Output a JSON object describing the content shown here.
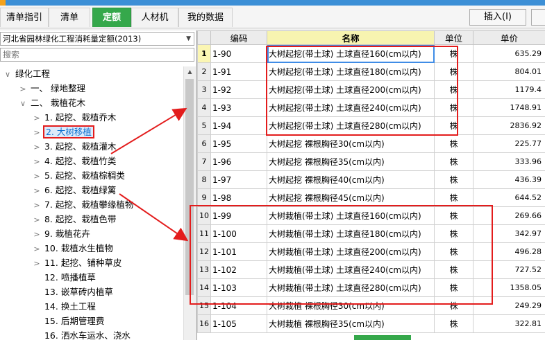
{
  "tabs": [
    {
      "label": "清单指引",
      "active": false
    },
    {
      "label": "清单",
      "active": false
    },
    {
      "label": "定额",
      "active": true
    },
    {
      "label": "人材机",
      "active": false
    },
    {
      "label": "我的数据",
      "active": false
    }
  ],
  "toolbar": {
    "insert_label": "插入(I)"
  },
  "library_select": {
    "value": "河北省园林绿化工程消耗量定额(2013)"
  },
  "search": {
    "placeholder": "搜索"
  },
  "tree": [
    {
      "toggle": "∨",
      "label": "绿化工程",
      "level": 0
    },
    {
      "toggle": ">",
      "label": "一、  绿地整理",
      "level": 1
    },
    {
      "toggle": "∨",
      "label": "二、  栽植花木",
      "level": 1
    },
    {
      "toggle": ">",
      "label": "1. 起挖、栽植乔木",
      "level": 2
    },
    {
      "toggle": ">",
      "label": "2. 大树移植",
      "level": 2,
      "selected": true
    },
    {
      "toggle": ">",
      "label": "3. 起挖、栽植灌木",
      "level": 2
    },
    {
      "toggle": ">",
      "label": "4. 起挖、栽植竹类",
      "level": 2
    },
    {
      "toggle": ">",
      "label": "5. 起挖、栽植棕榈类",
      "level": 2
    },
    {
      "toggle": ">",
      "label": "6. 起挖、栽植绿篱",
      "level": 2
    },
    {
      "toggle": ">",
      "label": "7. 起挖、栽植攀缘植物",
      "level": 2
    },
    {
      "toggle": ">",
      "label": "8. 起挖、栽植色带",
      "level": 2
    },
    {
      "toggle": ">",
      "label": "9. 栽植花卉",
      "level": 2
    },
    {
      "toggle": ">",
      "label": "10. 栽植水生植物",
      "level": 2
    },
    {
      "toggle": ">",
      "label": "11. 起挖、铺种草皮",
      "level": 2
    },
    {
      "toggle": "",
      "label": "12. 喷播植草",
      "level": 2
    },
    {
      "toggle": "",
      "label": "13. 嵌草砖内植草",
      "level": 2
    },
    {
      "toggle": "",
      "label": "14. 换土工程",
      "level": 2
    },
    {
      "toggle": "",
      "label": "15. 后期管理费",
      "level": 2
    },
    {
      "toggle": "",
      "label": "16. 洒水车运水、浇水",
      "level": 2
    }
  ],
  "columns": {
    "code": "编码",
    "name": "名称",
    "unit": "单位",
    "price": "单价"
  },
  "rows": [
    {
      "idx": "1",
      "code": "1-90",
      "name": "大树起挖(带土球) 土球直径160(cm以内)",
      "unit": "株",
      "price": "635.29"
    },
    {
      "idx": "2",
      "code": "1-91",
      "name": "大树起挖(带土球) 土球直径180(cm以内)",
      "unit": "株",
      "price": "804.01"
    },
    {
      "idx": "3",
      "code": "1-92",
      "name": "大树起挖(带土球) 土球直径200(cm以内)",
      "unit": "株",
      "price": "1179.4"
    },
    {
      "idx": "4",
      "code": "1-93",
      "name": "大树起挖(带土球) 土球直径240(cm以内)",
      "unit": "株",
      "price": "1748.91"
    },
    {
      "idx": "5",
      "code": "1-94",
      "name": "大树起挖(带土球) 土球直径280(cm以内)",
      "unit": "株",
      "price": "2836.92"
    },
    {
      "idx": "6",
      "code": "1-95",
      "name": "大树起挖 裸根胸径30(cm以内)",
      "unit": "株",
      "price": "225.77"
    },
    {
      "idx": "7",
      "code": "1-96",
      "name": "大树起挖 裸根胸径35(cm以内)",
      "unit": "株",
      "price": "333.96"
    },
    {
      "idx": "8",
      "code": "1-97",
      "name": "大树起挖 裸根胸径40(cm以内)",
      "unit": "株",
      "price": "436.39"
    },
    {
      "idx": "9",
      "code": "1-98",
      "name": "大树起挖 裸根胸径45(cm以内)",
      "unit": "株",
      "price": "644.52"
    },
    {
      "idx": "10",
      "code": "1-99",
      "name": "大树栽植(带土球) 土球直径160(cm以内)",
      "unit": "株",
      "price": "269.66"
    },
    {
      "idx": "11",
      "code": "1-100",
      "name": "大树栽植(带土球) 土球直径180(cm以内)",
      "unit": "株",
      "price": "342.97"
    },
    {
      "idx": "12",
      "code": "1-101",
      "name": "大树栽植(带土球) 土球直径200(cm以内)",
      "unit": "株",
      "price": "496.28"
    },
    {
      "idx": "13",
      "code": "1-102",
      "name": "大树栽植(带土球) 土球直径240(cm以内)",
      "unit": "株",
      "price": "727.52"
    },
    {
      "idx": "14",
      "code": "1-103",
      "name": "大树栽植(带土球) 土球直径280(cm以内)",
      "unit": "株",
      "price": "1358.05"
    },
    {
      "idx": "15",
      "code": "1-104",
      "name": "大树栽植 裸根胸径30(cm以内)",
      "unit": "株",
      "price": "249.29"
    },
    {
      "idx": "16",
      "code": "1-105",
      "name": "大树栽植 裸根胸径35(cm以内)",
      "unit": "株",
      "price": "322.81"
    }
  ]
}
